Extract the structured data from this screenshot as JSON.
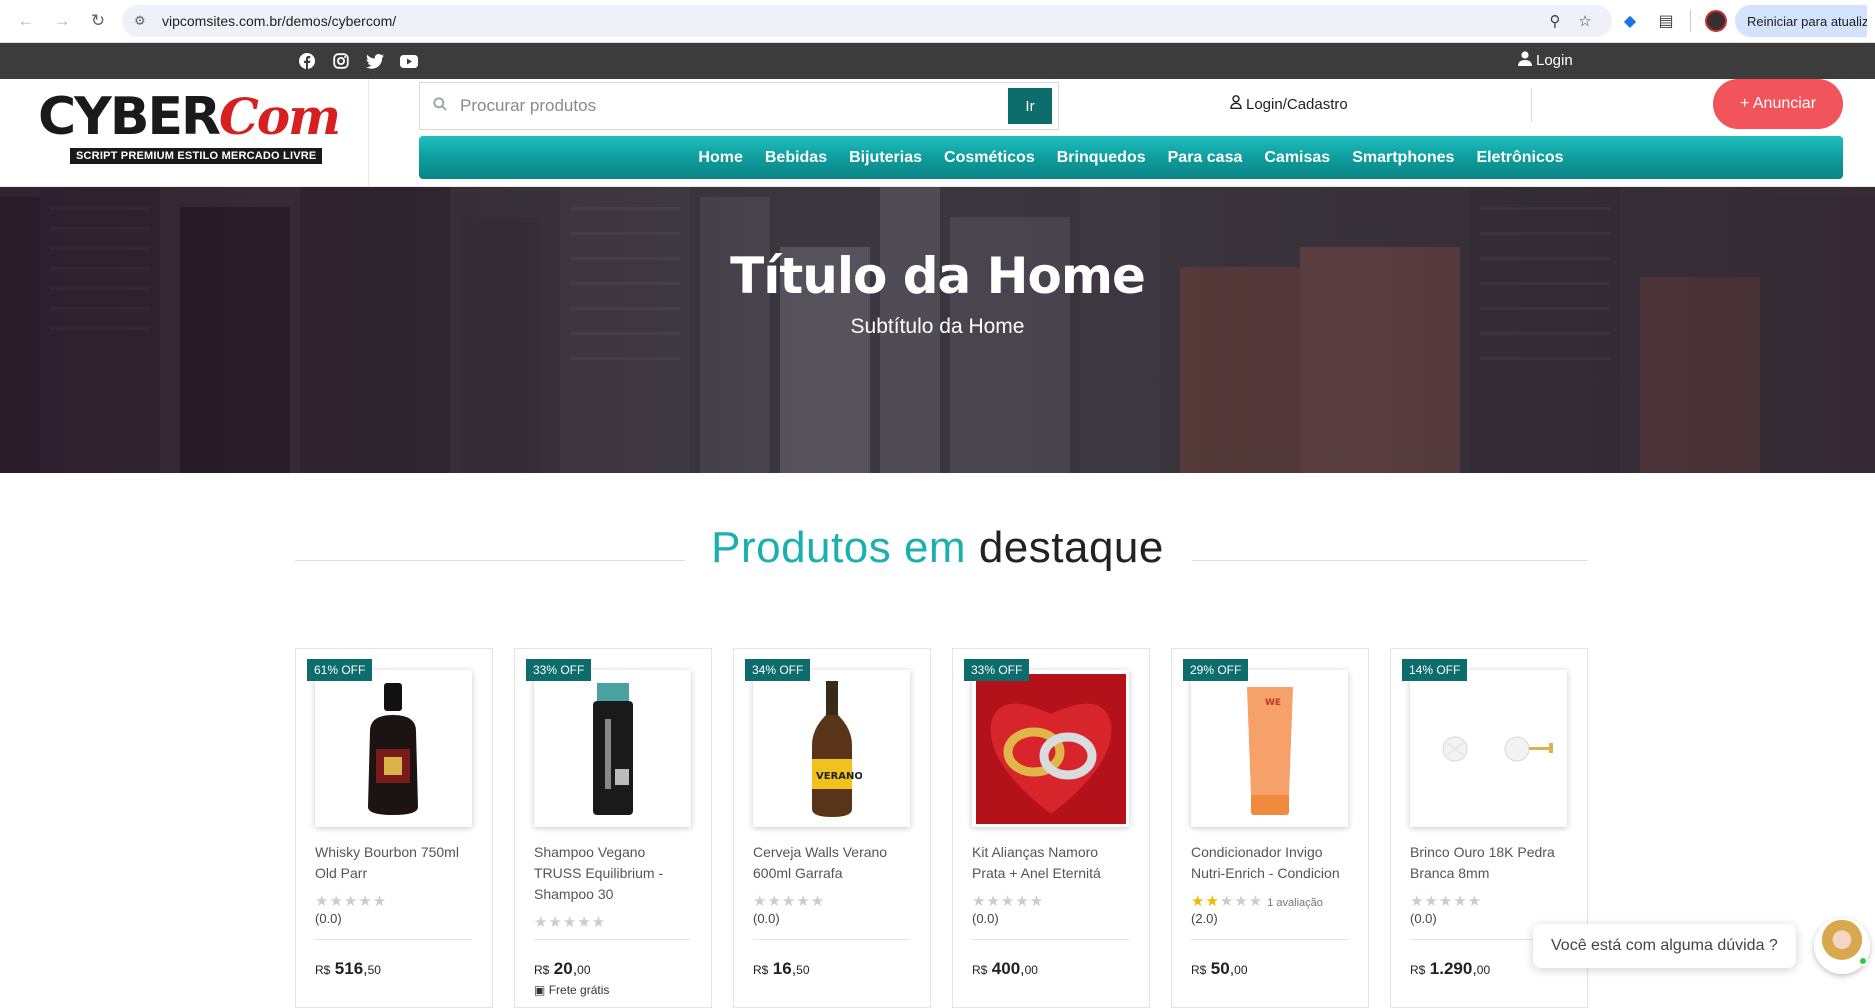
{
  "browser": {
    "url": "vipcomsites.com.br/demos/cybercom/",
    "restart_label": "Reiniciar para atualizar"
  },
  "topbar": {
    "social": [
      "facebook",
      "instagram",
      "twitter",
      "youtube"
    ],
    "login_label": "Login"
  },
  "header": {
    "logo_main": "CYBER",
    "logo_accent": "Com",
    "logo_sub": "SCRIPT PREMIUM ESTILO MERCADO LIVRE",
    "search_placeholder": "Procurar produtos",
    "search_button": "Ir",
    "login_cadastro": "Login/Cadastro",
    "anunciar": "+ Anunciar"
  },
  "categories": [
    "Home",
    "Bebidas",
    "Bijuterias",
    "Cosméticos",
    "Brinquedos",
    "Para casa",
    "Camisas",
    "Smartphones",
    "Eletrônicos"
  ],
  "hero": {
    "title": "Título da Home",
    "subtitle": "Subtítulo da Home"
  },
  "section": {
    "title_part1": "Produtos em",
    "title_part2": "destaque"
  },
  "products": [
    {
      "discount": "61% OFF",
      "name": "Whisky Bourbon 750ml Old Parr",
      "stars_filled": 0,
      "rating": "(0.0)",
      "reviews": "",
      "currency": "R$",
      "price_int": "516",
      "price_dec": "50",
      "shipping": ""
    },
    {
      "discount": "33% OFF",
      "name": "Shampoo Vegano TRUSS Equilibrium - Shampoo 30",
      "stars_filled": 0,
      "rating": "",
      "reviews": "",
      "currency": "R$",
      "price_int": "20",
      "price_dec": "00",
      "shipping": "Frete grátis"
    },
    {
      "discount": "34% OFF",
      "name": "Cerveja Walls Verano 600ml Garrafa",
      "stars_filled": 0,
      "rating": "(0.0)",
      "reviews": "",
      "currency": "R$",
      "price_int": "16",
      "price_dec": "50",
      "shipping": ""
    },
    {
      "discount": "33% OFF",
      "name": "Kit Alianças Namoro Prata + Anel Eternitá",
      "stars_filled": 0,
      "rating": "(0.0)",
      "reviews": "",
      "currency": "R$",
      "price_int": "400",
      "price_dec": "00",
      "shipping": ""
    },
    {
      "discount": "29% OFF",
      "name": "Condicionador Invigo Nutri-Enrich - Condicion",
      "stars_filled": 2,
      "rating": "(2.0)",
      "reviews": "1 avaliação",
      "currency": "R$",
      "price_int": "50",
      "price_dec": "00",
      "shipping": ""
    },
    {
      "discount": "14% OFF",
      "name": "Brinco Ouro 18K Pedra Branca 8mm",
      "stars_filled": 0,
      "rating": "(0.0)",
      "reviews": "",
      "currency": "R$",
      "price_int": "1.290",
      "price_dec": "00",
      "shipping": ""
    }
  ],
  "chat": {
    "prompt": "Você está com alguma dúvida ?"
  },
  "colors": {
    "accent_teal": "#0d6d6d",
    "nav_teal": "#14a8a8",
    "anunciar_red": "#f2545b",
    "topbar": "#3c3c3c"
  }
}
